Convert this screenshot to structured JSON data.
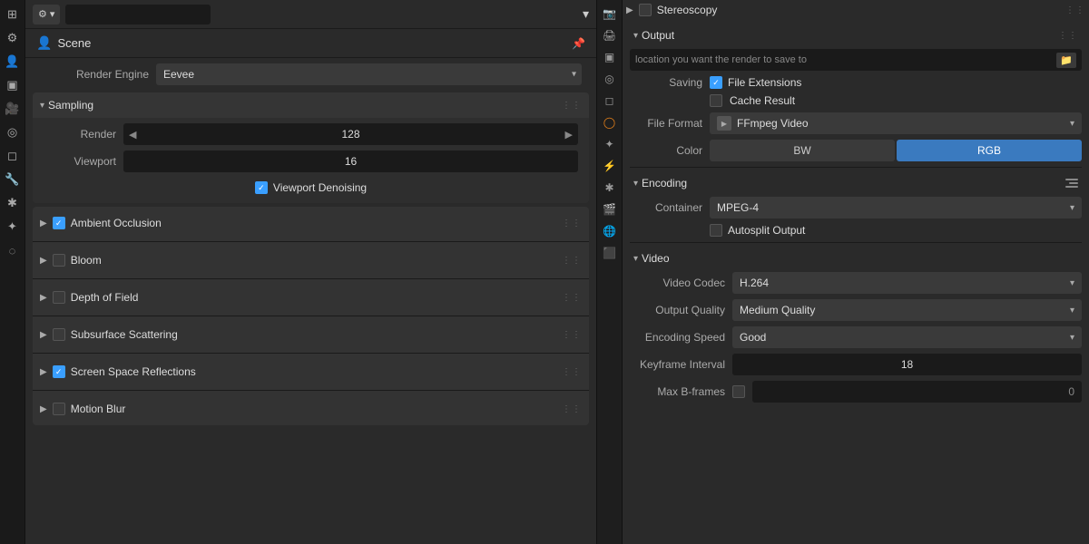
{
  "left_sidebar": {
    "icons": [
      {
        "name": "layout-icon",
        "symbol": "⊞",
        "active": false
      },
      {
        "name": "tools-icon",
        "symbol": "⚙",
        "active": false
      },
      {
        "name": "scene-icon",
        "symbol": "🎬",
        "active": false
      },
      {
        "name": "view-icon",
        "symbol": "▣",
        "active": false
      },
      {
        "name": "render-icon",
        "symbol": "🎥",
        "active": true
      },
      {
        "name": "compositing-icon",
        "symbol": "◎",
        "active": false
      },
      {
        "name": "object-icon",
        "symbol": "◻",
        "active": false
      },
      {
        "name": "modifier-icon",
        "symbol": "🔧",
        "active": false
      },
      {
        "name": "constraint-icon",
        "symbol": "✱",
        "active": false
      },
      {
        "name": "particles-icon",
        "symbol": "✦",
        "active": false
      },
      {
        "name": "data-icon",
        "symbol": "◌",
        "active": false
      }
    ]
  },
  "header": {
    "editor_type": "Properties",
    "search_placeholder": "",
    "dropdown_symbol": "▾"
  },
  "scene": {
    "title": "Scene",
    "icon": "👤"
  },
  "render_engine": {
    "label": "Render Engine",
    "value": "Eevee"
  },
  "sampling": {
    "title": "Sampling",
    "render_label": "Render",
    "render_value": "128",
    "viewport_label": "Viewport",
    "viewport_value": "16",
    "denoising_label": "Viewport Denoising",
    "denoising_checked": true
  },
  "effects": [
    {
      "name": "Ambient Occlusion",
      "checked": true,
      "key": "ambient-occlusion"
    },
    {
      "name": "Bloom",
      "checked": false,
      "key": "bloom"
    },
    {
      "name": "Depth of Field",
      "checked": false,
      "key": "depth-of-field"
    },
    {
      "name": "Subsurface Scattering",
      "checked": false,
      "key": "subsurface-scattering"
    },
    {
      "name": "Screen Space Reflections",
      "checked": true,
      "key": "screen-space-reflections"
    },
    {
      "name": "Motion Blur",
      "checked": false,
      "key": "motion-blur"
    }
  ],
  "right_icons": [
    {
      "name": "camera-icon",
      "symbol": "📷",
      "active": false
    },
    {
      "name": "output-icon",
      "symbol": "🖨",
      "active": false
    },
    {
      "name": "view3d-icon",
      "symbol": "▣",
      "active": false
    },
    {
      "name": "world-icon",
      "symbol": "◎",
      "active": false
    },
    {
      "name": "object-data-icon",
      "symbol": "◻",
      "active": false
    },
    {
      "name": "material-icon",
      "symbol": "◯",
      "active": true
    },
    {
      "name": "particle-icon",
      "symbol": "✦",
      "active": false
    },
    {
      "name": "physics-icon",
      "symbol": "⚡",
      "active": false
    },
    {
      "name": "constraint2-icon",
      "symbol": "✱",
      "active": false
    },
    {
      "name": "scene2-icon",
      "symbol": "🎬",
      "active": false
    },
    {
      "name": "world2-icon",
      "symbol": "🌐",
      "active": false
    },
    {
      "name": "render2-icon",
      "symbol": "⬛",
      "active": false
    }
  ],
  "right_panel": {
    "stereoscopy": {
      "label": "Stereoscopy"
    },
    "output": {
      "title": "Output",
      "path_placeholder": "location you want the render to save to",
      "saving_label": "Saving",
      "file_extensions_label": "File Extensions",
      "file_extensions_checked": true,
      "cache_result_label": "Cache Result",
      "cache_result_checked": false,
      "file_format_label": "File Format",
      "file_format_value": "FFmpeg Video",
      "color_label": "Color",
      "color_bw": "BW",
      "color_rgb": "RGB",
      "color_active": "RGB"
    },
    "encoding": {
      "title": "Encoding",
      "container_label": "Container",
      "container_value": "MPEG-4",
      "autosplit_label": "Autosplit Output",
      "autosplit_checked": false
    },
    "video": {
      "title": "Video",
      "codec_label": "Video Codec",
      "codec_value": "H.264",
      "quality_label": "Output Quality",
      "quality_value": "Medium Quality",
      "speed_label": "Encoding Speed",
      "speed_value": "Good",
      "keyframe_label": "Keyframe Interval",
      "keyframe_value": "18",
      "bframes_label": "Max B-frames",
      "bframes_value": "0",
      "bframes_checked": false
    }
  }
}
